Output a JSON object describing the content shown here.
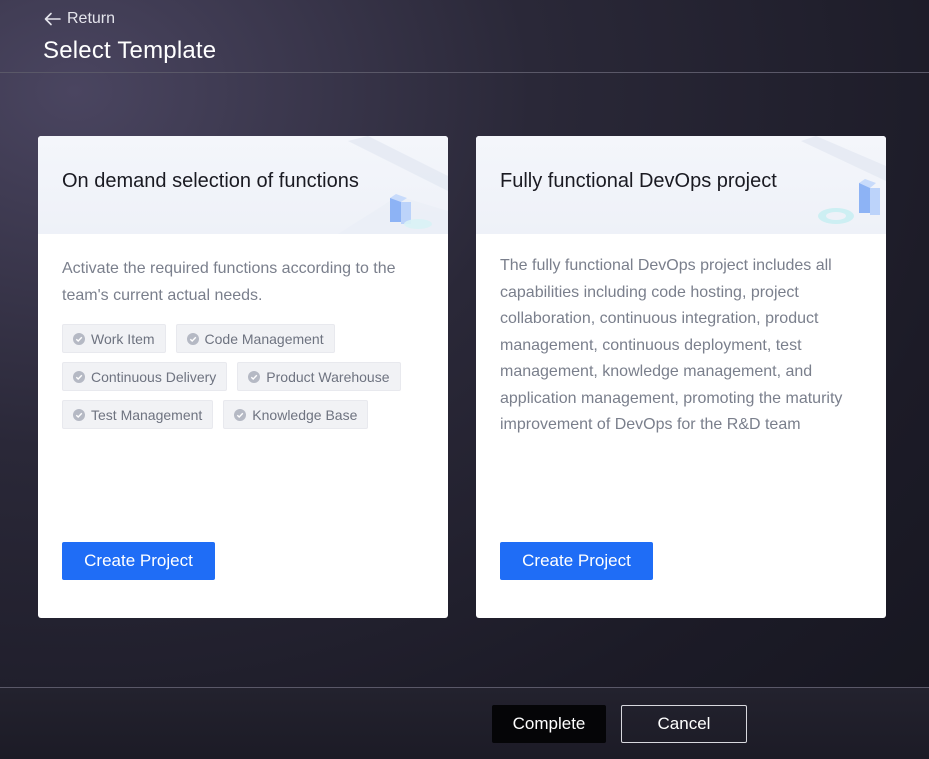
{
  "header": {
    "return_label": "Return",
    "return_icon": "arrow-left-icon",
    "title": "Select Template"
  },
  "cards": [
    {
      "title": "On demand selection of functions",
      "description": "Activate the required functions according to the team's current actual needs.",
      "tags": [
        "Work Item",
        "Code Management",
        "Continuous Delivery",
        "Product Warehouse",
        "Test Management",
        "Knowledge Base"
      ],
      "button_label": "Create Project"
    },
    {
      "title": "Fully functional DevOps project",
      "description": "The fully functional DevOps project includes all capabilities including code hosting, project collaboration, continuous integration, product management, continuous deployment, test management, knowledge management, and application management, promoting the maturity improvement of DevOps for the R&D team",
      "button_label": "Create Project"
    }
  ],
  "footer": {
    "complete_label": "Complete",
    "cancel_label": "Cancel"
  },
  "colors": {
    "primary": "#1f6df6",
    "tag_bg": "#f1f2f5",
    "tag_text": "#6e7380",
    "description_text": "#7a7f8c"
  }
}
